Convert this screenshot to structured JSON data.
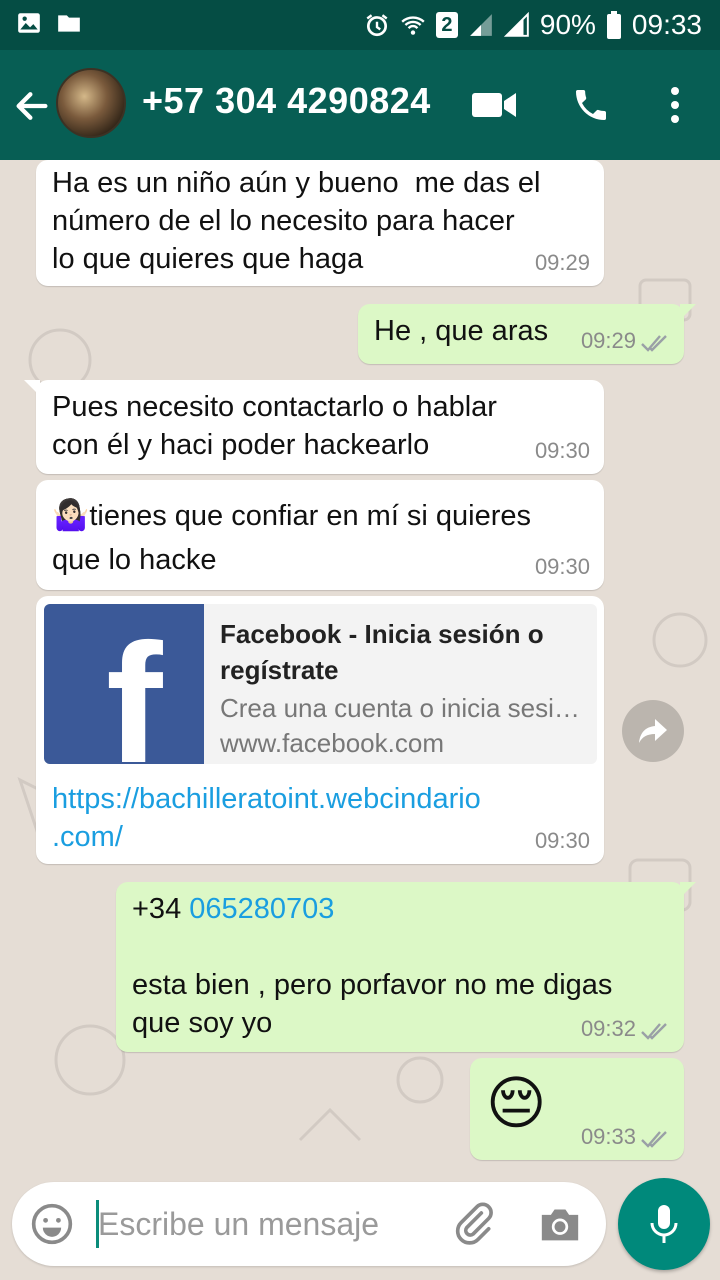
{
  "status_bar": {
    "battery": "90%",
    "time": "09:33",
    "sim_badge": "2"
  },
  "header": {
    "contact": "+57 304 4290824"
  },
  "messages": [
    {
      "text": "Ha es un niño aún y bueno  me das el\nnúmero de el lo necesito para hacer\nlo que quieres que haga",
      "time": "09:29"
    },
    {
      "text": "He , que aras",
      "time": "09:29"
    },
    {
      "text": "Pues necesito contactarlo o hablar\ncon él y haci poder hackearlo",
      "time": "09:30"
    },
    {
      "emoji": "🤷🏻‍♀️",
      "text": "tienes que confiar en mí si quieres\nque lo hacke",
      "time": "09:30"
    },
    {
      "preview_title": "Facebook - Inicia sesión o regístrate",
      "preview_desc": "Crea una cuenta o inicia sesión en Facebook",
      "preview_host": "www.facebook.com",
      "link": "https://bachilleratoint.webcindario\n.com/",
      "time": "09:30"
    },
    {
      "prefix": "+34 ",
      "phone": "065280703",
      "text": "esta bien , pero porfavor no me digas\nque soy yo",
      "time": "09:32"
    },
    {
      "emoji": "😔",
      "time": "09:33"
    }
  ],
  "composer": {
    "placeholder": "Escribe un mensaje"
  },
  "colors": {
    "header": "#075e54",
    "status_bar": "#054d44",
    "outgoing": "#dcf8c6",
    "incoming": "#ffffff",
    "link": "#1a9ee0",
    "mic": "#00897b",
    "ticks": "#9aa0a6"
  },
  "icons": [
    "image-icon",
    "folder-icon",
    "alarm-icon",
    "wifi-icon",
    "signal-icon",
    "battery-icon",
    "back-arrow-icon",
    "video-call-icon",
    "phone-icon",
    "more-icon",
    "share-icon",
    "emoji-icon",
    "attach-icon",
    "camera-icon",
    "mic-icon"
  ]
}
